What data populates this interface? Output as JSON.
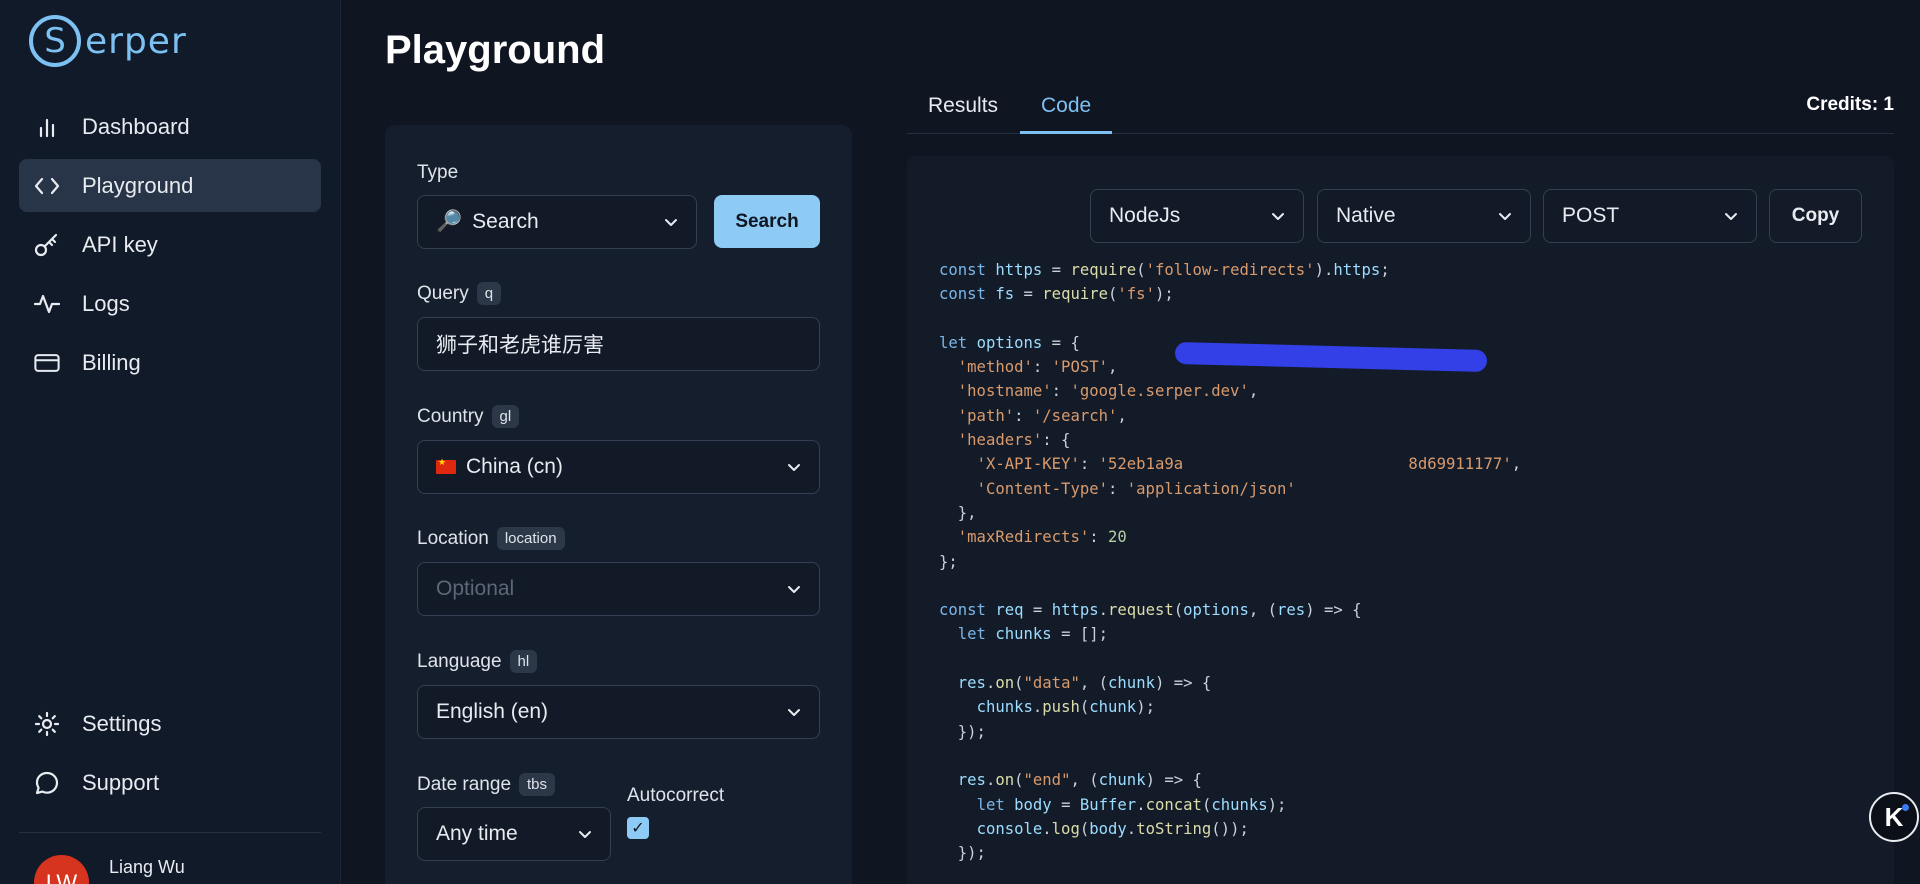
{
  "brand": {
    "letter": "S",
    "name": "erper"
  },
  "sidebar": {
    "items": [
      {
        "label": "Dashboard",
        "icon": "bar-chart-icon"
      },
      {
        "label": "Playground",
        "icon": "code-icon",
        "active": true
      },
      {
        "label": "API key",
        "icon": "key-icon"
      },
      {
        "label": "Logs",
        "icon": "activity-icon"
      },
      {
        "label": "Billing",
        "icon": "credit-card-icon"
      }
    ],
    "bottom": [
      {
        "label": "Settings",
        "icon": "gear-icon"
      },
      {
        "label": "Support",
        "icon": "chat-icon"
      }
    ],
    "user": {
      "initials": "LW",
      "name": "Liang Wu"
    }
  },
  "page": {
    "title": "Playground"
  },
  "form": {
    "type_label": "Type",
    "type_value": "Search",
    "search_button": "Search",
    "query_label": "Query",
    "query_tag": "q",
    "query_value": "狮子和老虎谁厉害",
    "country_label": "Country",
    "country_tag": "gl",
    "country_value": "China (cn)",
    "location_label": "Location",
    "location_tag": "location",
    "location_placeholder": "Optional",
    "language_label": "Language",
    "language_tag": "hl",
    "language_value": "English (en)",
    "date_label": "Date range",
    "date_tag": "tbs",
    "date_value": "Any time",
    "autocorrect_label": "Autocorrect",
    "autocorrect_checked": true
  },
  "tabs": [
    {
      "label": "Results",
      "active": false
    },
    {
      "label": "Code",
      "active": true
    }
  ],
  "credits": "Credits: 1",
  "code_panel": {
    "language": "NodeJs",
    "library": "Native",
    "method": "POST",
    "copy_label": "Copy"
  },
  "colors": {
    "accent": "#7cc1f2",
    "background": "#0f1521",
    "avatar": "#d6341f"
  }
}
